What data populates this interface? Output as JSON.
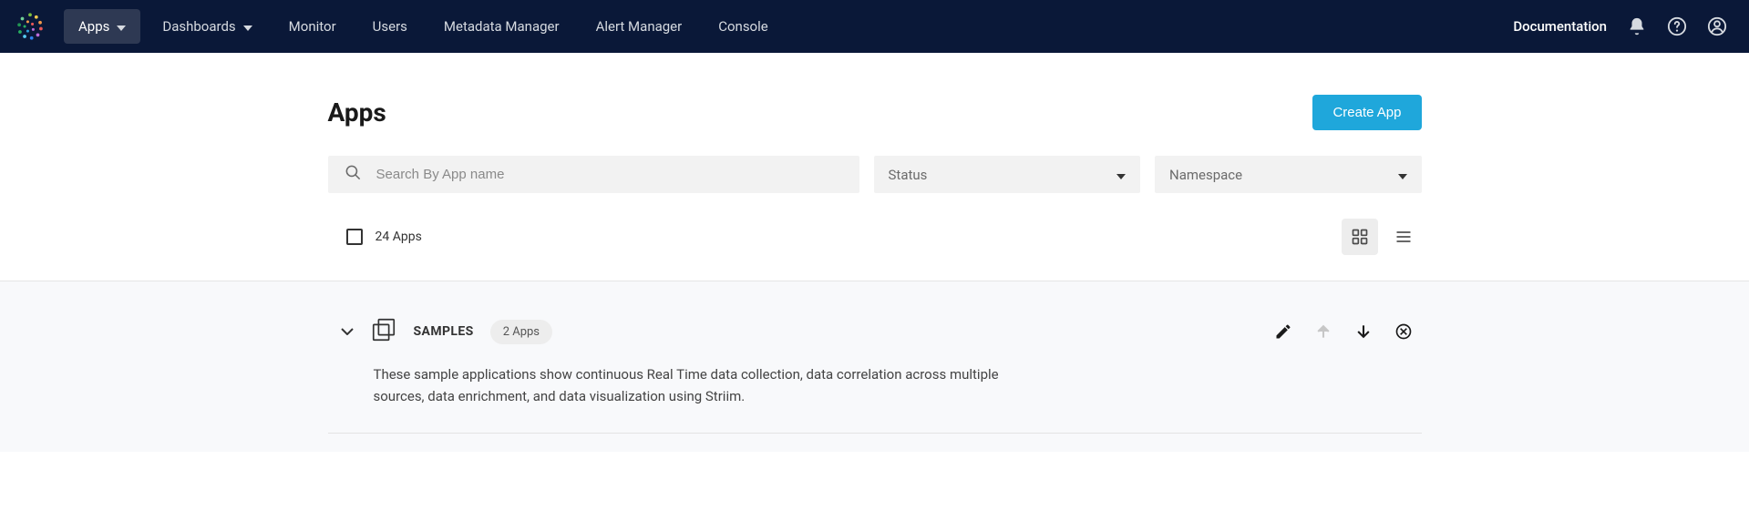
{
  "nav": {
    "items": [
      {
        "label": "Apps"
      },
      {
        "label": "Dashboards"
      },
      {
        "label": "Monitor"
      },
      {
        "label": "Users"
      },
      {
        "label": "Metadata Manager"
      },
      {
        "label": "Alert Manager"
      },
      {
        "label": "Console"
      }
    ],
    "documentation": "Documentation"
  },
  "page": {
    "title": "Apps",
    "create_button": "Create App"
  },
  "filters": {
    "search_placeholder": "Search By App name",
    "status_label": "Status",
    "namespace_label": "Namespace"
  },
  "count": {
    "label": "24 Apps"
  },
  "group": {
    "name": "SAMPLES",
    "badge": "2 Apps",
    "description": "These sample applications show continuous Real Time data collection, data correlation across multiple sources, data enrichment, and data visualization using Striim."
  }
}
